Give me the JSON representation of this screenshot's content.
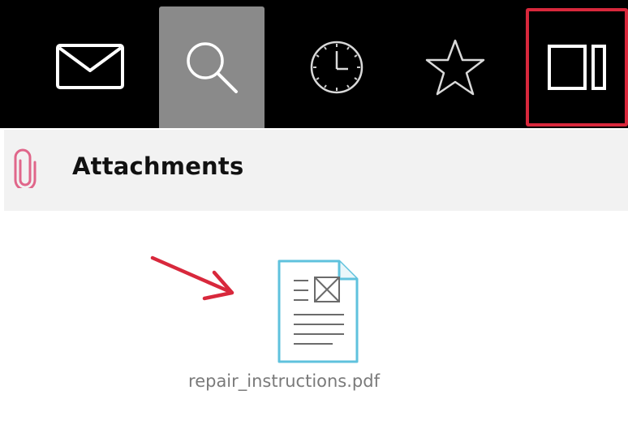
{
  "toolbar": {
    "icons": [
      "mail-icon",
      "search-icon",
      "clock-icon",
      "star-icon",
      "panel-toggle-icon"
    ],
    "active_icon": "search-icon",
    "highlighted_icon": "panel-toggle-icon",
    "colors": {
      "bar_background": "#000000",
      "active_background": "#8a8a8a",
      "highlight_border": "#d8283c"
    }
  },
  "section": {
    "icon": "paperclip-icon",
    "title": "Attachments"
  },
  "attachment": {
    "icon": "pdf-file-icon",
    "file_name": "repair_instructions.pdf"
  },
  "annotation": {
    "arrow_icon": "red-arrow-icon",
    "color": "#d8283c"
  }
}
